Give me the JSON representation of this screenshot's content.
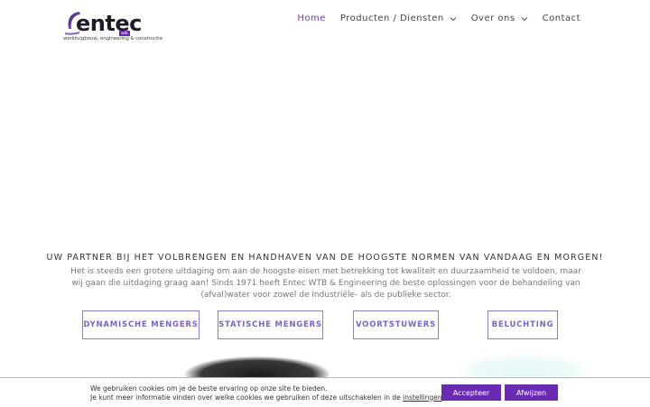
{
  "brand": {
    "name": "entec",
    "tagline": "werktuigbouw, engineering & constructie",
    "tag": "wtb"
  },
  "nav": {
    "items": [
      {
        "label": "Home",
        "active": true
      },
      {
        "label": "Producten / Diensten",
        "has_dropdown": true
      },
      {
        "label": "Over ons",
        "has_dropdown": true
      },
      {
        "label": "Contact"
      }
    ]
  },
  "hero": {
    "headline": "UW PARTNER BIJ HET VOLBRENGEN EN HANDHAVEN VAN DE HOOGSTE NORMEN VAN VANDAAG EN MORGEN!",
    "intro": "Het is steeds een grotere uitdaging om aan de hoogste eisen met betrekking tot kwaliteit en duurzaamheid te voldoen, maar wij gaan die uitdaging graag aan! Sinds 1971 heeft Entec WTB & Engineering de beste oplossingen voor de behandeling van (afval)water voor zowel de industriële- als de publieke sector."
  },
  "services": [
    {
      "label": "DYNAMISCHE MENGERS"
    },
    {
      "label": "STATISCHE MENGERS"
    },
    {
      "label": "VOORTSTUWERS"
    },
    {
      "label": "BELUCHTING"
    }
  ],
  "cookie": {
    "line1": "We gebruiken cookies om je de beste ervaring op onze site te bieden.",
    "line2_prefix": "Je kunt meer informatie vinden over welke cookies we gebruiken of deze uitschakelen in de ",
    "link": "instellingen",
    "line2_suffix": ".",
    "accept_label": "Accepteer",
    "reject_label": "Afwijzen"
  },
  "colors": {
    "accent": "#6b3bb0",
    "button_border": "#8f7ac8",
    "cookie_button": "#6a2bb3"
  }
}
